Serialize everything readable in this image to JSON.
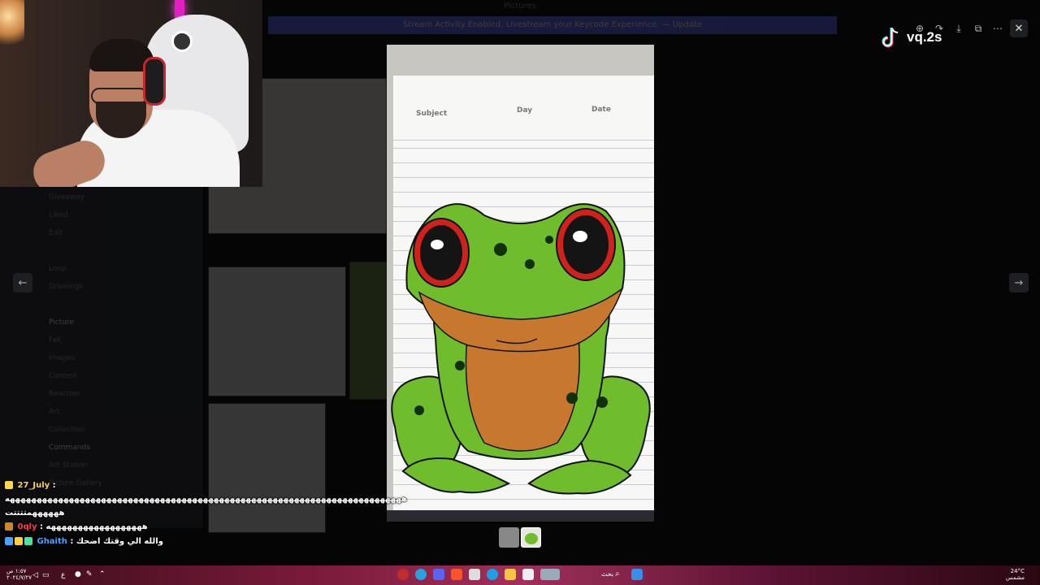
{
  "window": {
    "title": "Pictures",
    "banner": "Stream Activity Enabled: Livestream your Keycode Experience. — Update"
  },
  "viewer": {
    "toolbar_icons": [
      "zoom-in-icon",
      "share-icon",
      "download-icon",
      "open-external-icon",
      "more-icon"
    ],
    "close_icon": "close-icon",
    "prev_icon": "arrow-left-icon",
    "next_icon": "arrow-right-icon",
    "paper_fields": {
      "subject": "Subject",
      "day": "Day",
      "date": "Date"
    },
    "thumbnails_count": 2,
    "selected_thumbnail": 2
  },
  "tiktok": {
    "handle": "vq.2s"
  },
  "chat": [
    {
      "user": "27_July",
      "sep": " :",
      "message": ""
    },
    {
      "user": "",
      "sep": "",
      "message": "ههههههههههههههههههههههههههههههههههههههههههههههههههههههههههههههههههههههههههه"
    },
    {
      "user": "",
      "sep": "",
      "message": "ههههههمتتتتت"
    },
    {
      "user": "0qly",
      "sep": " : ",
      "message": "ههههههههههههههههههه"
    },
    {
      "user": "Ghaith",
      "sep": " : ",
      "message": "والله الي وقتك اضحك"
    }
  ],
  "taskbar": {
    "search_text": "بحث",
    "weather_temp": "24°C",
    "weather_desc": "مشمس",
    "time": "١:٥٧ ص",
    "date": "٢٠٢٤/٧/٢٧",
    "lang": "ع"
  },
  "background_sidebar": [
    "Giveaway",
    "Liked",
    "Edit",
    "Loop",
    "Drawings",
    "Picture",
    "Fall",
    "Images",
    "Contest",
    "Reaction",
    "Art",
    "Collection",
    "Commands",
    "Art Station",
    "Picture Gallery"
  ],
  "colors": {
    "accent": "#5865f2",
    "tiktok_cyan": "#25f4ee",
    "tiktok_red": "#fe2c55",
    "chat_user_gold": "#ffd54a",
    "chat_user_red": "#ff3b4a",
    "chat_user_blue": "#4aa3ff"
  }
}
